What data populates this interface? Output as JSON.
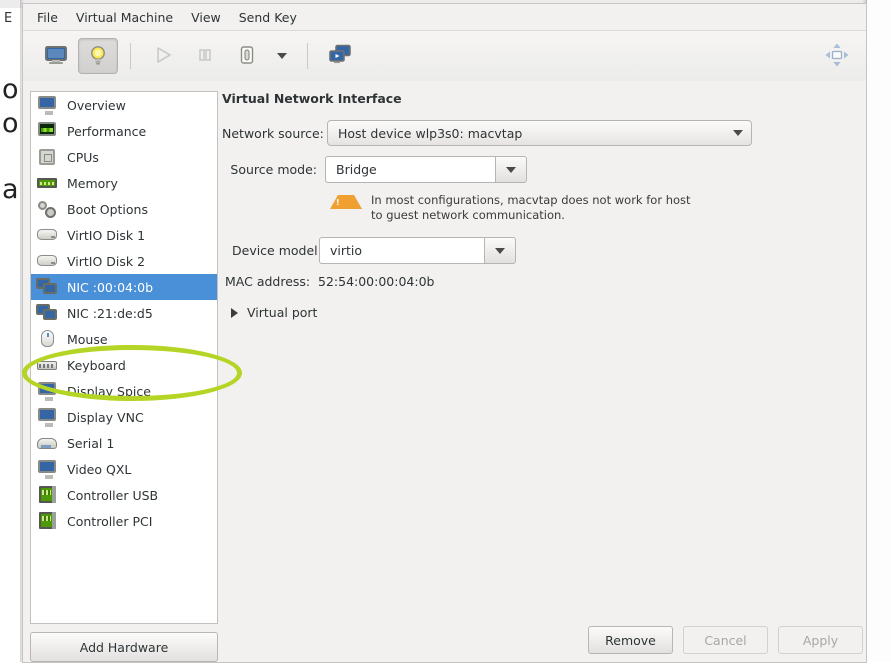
{
  "background": {
    "edge_char": "E",
    "left_texts": [
      "o",
      "o",
      "a"
    ]
  },
  "window": {
    "menubar": [
      {
        "label": "File",
        "name": "menu-file"
      },
      {
        "label": "Virtual Machine",
        "name": "menu-virtual-machine"
      },
      {
        "label": "View",
        "name": "menu-view"
      },
      {
        "label": "Send Key",
        "name": "menu-send-key"
      }
    ],
    "toolbar": {
      "console_icon": "monitor-icon",
      "details_icon": "lightbulb-icon",
      "run_icon": "play-icon",
      "pause_icon": "pause-icon",
      "shutdown_icon": "power-icon",
      "shutdown_menu_icon": "chevron-down-icon",
      "snapshots_icon": "screens-icon",
      "fullscreen_icon": "fullscreen-icon"
    }
  },
  "sidebar": {
    "selected_index": 7,
    "items": [
      {
        "label": "Overview",
        "icon": "monitor-icon"
      },
      {
        "label": "Performance",
        "icon": "performance-monitor-icon"
      },
      {
        "label": "CPUs",
        "icon": "cpu-chip-icon"
      },
      {
        "label": "Memory",
        "icon": "memory-stick-icon"
      },
      {
        "label": "Boot Options",
        "icon": "gears-icon"
      },
      {
        "label": "VirtIO Disk 1",
        "icon": "disk-icon"
      },
      {
        "label": "VirtIO Disk 2",
        "icon": "disk-icon"
      },
      {
        "label": "NIC :00:04:0b",
        "icon": "network-card-icon"
      },
      {
        "label": "NIC :21:de:d5",
        "icon": "network-card-icon"
      },
      {
        "label": "Mouse",
        "icon": "mouse-icon"
      },
      {
        "label": "Keyboard",
        "icon": "keyboard-icon"
      },
      {
        "label": "Display Spice",
        "icon": "monitor-icon"
      },
      {
        "label": "Display VNC",
        "icon": "monitor-icon"
      },
      {
        "label": "Serial 1",
        "icon": "serial-port-icon"
      },
      {
        "label": "Video QXL",
        "icon": "monitor-icon"
      },
      {
        "label": "Controller USB",
        "icon": "controller-card-icon"
      },
      {
        "label": "Controller PCI",
        "icon": "controller-card-icon"
      }
    ],
    "add_hardware_label": "Add Hardware"
  },
  "detail": {
    "section_title": "Virtual Network Interface",
    "network_source": {
      "label": "Network source:",
      "value": "Host device wlp3s0: macvtap"
    },
    "source_mode": {
      "label": "Source mode:",
      "value": "Bridge"
    },
    "warning": {
      "icon": "warning-triangle-icon",
      "line1": "In most configurations, macvtap does not work for host",
      "line2": "to guest network communication."
    },
    "device_model": {
      "label": "Device model:",
      "value": "virtio"
    },
    "mac_address": {
      "label": "MAC address:",
      "value": "52:54:00:00:04:0b"
    },
    "virtual_port": {
      "label": "Virtual port",
      "expander_icon": "triangle-right-icon",
      "expanded": "false"
    }
  },
  "buttons": {
    "remove": "Remove",
    "cancel": "Cancel",
    "apply": "Apply"
  },
  "annotation": {
    "type": "ellipse-highlight",
    "color": "#b4d525",
    "target": "NIC :00:04:0b"
  },
  "colors": {
    "selection_blue": "#4a90d9",
    "window_bg": "#f2f1f0",
    "annotation_green": "#b4d525",
    "warning_orange": "#f0a030"
  }
}
